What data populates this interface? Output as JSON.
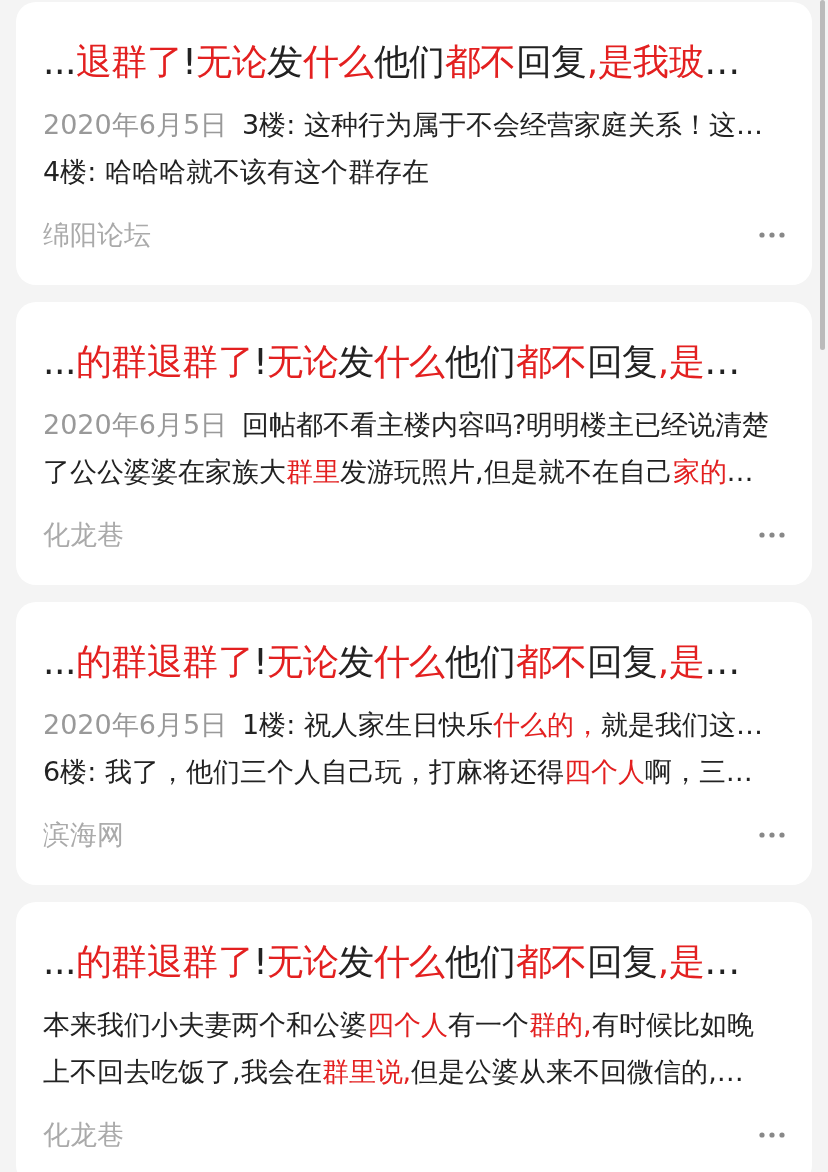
{
  "results": [
    {
      "title": [
        {
          "text": "...",
          "highlight": false
        },
        {
          "text": "退群了",
          "highlight": true
        },
        {
          "text": "!",
          "highlight": false
        },
        {
          "text": "无论",
          "highlight": true
        },
        {
          "text": "发",
          "highlight": false
        },
        {
          "text": "什么",
          "highlight": true
        },
        {
          "text": "他们",
          "highlight": false
        },
        {
          "text": "都不",
          "highlight": true
        },
        {
          "text": "回复",
          "highlight": false
        },
        {
          "text": ",是我玻",
          "highlight": true
        },
        {
          "text": "…",
          "highlight": false
        }
      ],
      "date": "2020年6月5日",
      "snippet_lines": [
        [
          {
            "text": "3楼: 这种行为属于不会经营家庭关系！这…",
            "highlight": false
          }
        ],
        [
          {
            "text": "4楼: 哈哈哈就不该有这个群存在",
            "highlight": false
          }
        ]
      ],
      "source": "绵阳论坛"
    },
    {
      "title": [
        {
          "text": "...",
          "highlight": false
        },
        {
          "text": "的群退群了",
          "highlight": true
        },
        {
          "text": "!",
          "highlight": false
        },
        {
          "text": "无论",
          "highlight": true
        },
        {
          "text": "发",
          "highlight": false
        },
        {
          "text": "什么",
          "highlight": true
        },
        {
          "text": "他们",
          "highlight": false
        },
        {
          "text": "都不",
          "highlight": true
        },
        {
          "text": "回复",
          "highlight": false
        },
        {
          "text": ",是",
          "highlight": true
        },
        {
          "text": "…",
          "highlight": false
        }
      ],
      "date": "2020年6月5日",
      "snippet_lines": [
        [
          {
            "text": "回帖都不看主楼内容吗?明明楼主已经说清楚",
            "highlight": false
          }
        ],
        [
          {
            "text": "了公公婆婆在家族大",
            "highlight": false
          },
          {
            "text": "群里",
            "highlight": true
          },
          {
            "text": "发游玩照片,但是就不在自己",
            "highlight": false
          },
          {
            "text": "家的",
            "highlight": true
          },
          {
            "text": "…",
            "highlight": false
          }
        ]
      ],
      "source": "化龙巷"
    },
    {
      "title": [
        {
          "text": "...",
          "highlight": false
        },
        {
          "text": "的群退群了",
          "highlight": true
        },
        {
          "text": "!",
          "highlight": false
        },
        {
          "text": "无论",
          "highlight": true
        },
        {
          "text": "发",
          "highlight": false
        },
        {
          "text": "什么",
          "highlight": true
        },
        {
          "text": "他们",
          "highlight": false
        },
        {
          "text": "都不",
          "highlight": true
        },
        {
          "text": "回复",
          "highlight": false
        },
        {
          "text": ",是",
          "highlight": true
        },
        {
          "text": "…",
          "highlight": false
        }
      ],
      "date": "2020年6月5日",
      "snippet_lines": [
        [
          {
            "text": "1楼: 祝人家生日快乐",
            "highlight": false
          },
          {
            "text": "什么的，",
            "highlight": true
          },
          {
            "text": "就是我们这…",
            "highlight": false
          }
        ],
        [
          {
            "text": "6楼: 我了，他们三个人自己玩，打麻将还得",
            "highlight": false
          },
          {
            "text": "四个人",
            "highlight": true
          },
          {
            "text": "啊，三…",
            "highlight": false
          }
        ]
      ],
      "source": "滨海网"
    },
    {
      "title": [
        {
          "text": "...",
          "highlight": false
        },
        {
          "text": "的群退群了",
          "highlight": true
        },
        {
          "text": "!",
          "highlight": false
        },
        {
          "text": "无论",
          "highlight": true
        },
        {
          "text": "发",
          "highlight": false
        },
        {
          "text": "什么",
          "highlight": true
        },
        {
          "text": "他们",
          "highlight": false
        },
        {
          "text": "都不",
          "highlight": true
        },
        {
          "text": "回复",
          "highlight": false
        },
        {
          "text": ",是",
          "highlight": true
        },
        {
          "text": "…",
          "highlight": false
        }
      ],
      "snippet_lines": [
        [
          {
            "text": "本来我们小夫妻两个和公婆",
            "highlight": false
          },
          {
            "text": "四个人",
            "highlight": true
          },
          {
            "text": "有一个",
            "highlight": false
          },
          {
            "text": "群的,",
            "highlight": true
          },
          {
            "text": "有时候比如晚",
            "highlight": false
          }
        ],
        [
          {
            "text": "上不回去吃饭了,我会在",
            "highlight": false
          },
          {
            "text": "群里说,",
            "highlight": true
          },
          {
            "text": "但是公婆从来不回微信的,…",
            "highlight": false
          }
        ]
      ],
      "source": "化龙巷"
    }
  ]
}
